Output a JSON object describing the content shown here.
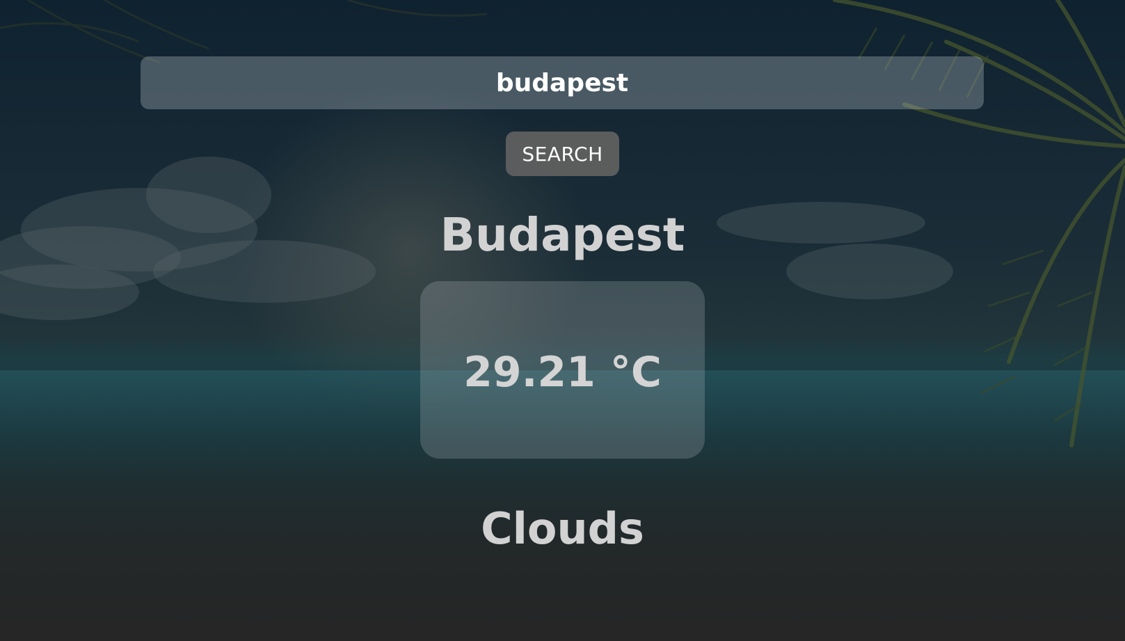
{
  "search": {
    "value": "budapest",
    "button_label": "SEARCH"
  },
  "weather": {
    "city": "Budapest",
    "temperature": "29.21 °C",
    "condition": "Clouds"
  },
  "colors": {
    "text_primary": "#ffffff",
    "text_secondary": "#d2d2d2",
    "button_bg": "#5f5f5f"
  },
  "background": {
    "scene": "beach-with-palm-tree"
  }
}
